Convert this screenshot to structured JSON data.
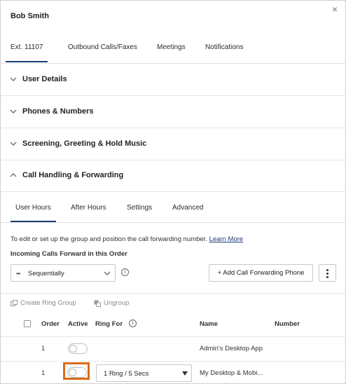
{
  "header": {
    "title": "Bob Smith",
    "close_glyph": "×"
  },
  "tabs": [
    {
      "label": "Ext. 11107",
      "active": true
    },
    {
      "label": "Outbound Calls/Faxes",
      "active": false
    },
    {
      "label": "Meetings",
      "active": false
    },
    {
      "label": "Notifications",
      "active": false
    }
  ],
  "sections": [
    {
      "label": "User Details",
      "expanded": false
    },
    {
      "label": "Phones & Numbers",
      "expanded": false
    },
    {
      "label": "Screening, Greeting & Hold Music",
      "expanded": false
    },
    {
      "label": "Call Handling & Forwarding",
      "expanded": true
    }
  ],
  "subtabs": [
    {
      "label": "User Hours",
      "active": true
    },
    {
      "label": "After Hours",
      "active": false
    },
    {
      "label": "Settings",
      "active": false
    },
    {
      "label": "Advanced",
      "active": false
    }
  ],
  "forwarding": {
    "description": "To edit or set up the group and position the call forwarding number.",
    "learn_more": "Learn More",
    "heading": "Incoming Calls Forward in this Order",
    "order_mode": "Sequentially",
    "add_button": "+ Add Call Forwarding Phone",
    "create_ring_group": "Create Ring Group",
    "ungroup": "Ungroup"
  },
  "table": {
    "columns": {
      "order": "Order",
      "active": "Active",
      "ring_for": "Ring For",
      "name": "Name",
      "number": "Number"
    },
    "rows": [
      {
        "order": "1",
        "active": false,
        "ring_for": "",
        "name": "Admin's Desktop App",
        "number": ""
      },
      {
        "order": "1",
        "active": false,
        "ring_for": "1 Ring / 5 Secs",
        "name": "My Desktop & Mobi...",
        "number": ""
      }
    ]
  },
  "colors": {
    "accent": "#1a3c78",
    "highlight": "#d96b1c",
    "border": "#cfcfcf"
  }
}
